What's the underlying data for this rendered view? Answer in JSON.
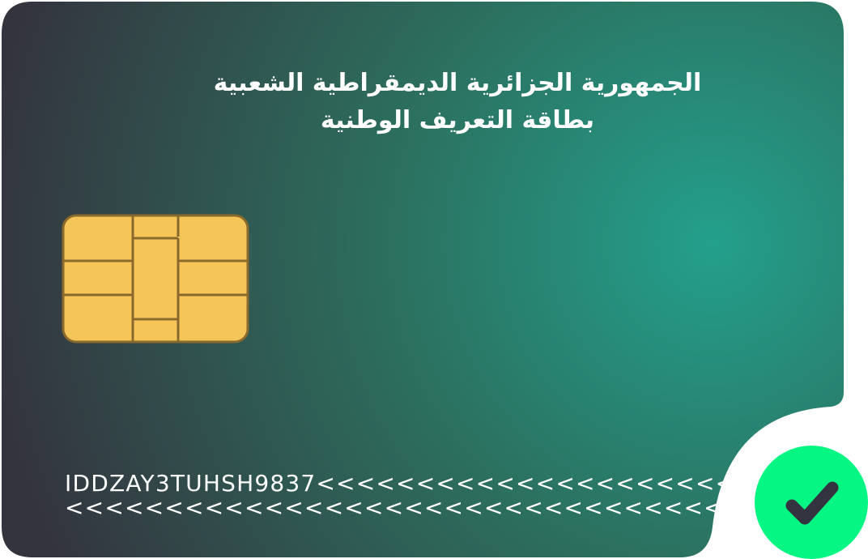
{
  "card": {
    "title_line1": "الجمهورية الجزائرية الديمقراطية الشعبية",
    "title_line2": "بطاقة التعريف الوطنية",
    "mrz_line1": "IDDZAY3TUHSH9837<<<<<<<<<<<<<<<<<<<<<",
    "mrz_line2": "<<<<<<<<<<<<<<<<<<<<<<<<<<<<<<<<<<<<<"
  },
  "colors": {
    "card_dark": "#34343e",
    "card_green": "#23a08c",
    "chip_gold": "#f5c55a",
    "chip_border": "#8a6a2c",
    "badge_green": "#06f684",
    "check_dark": "#33343f"
  },
  "icons": {
    "chip": "sim-chip-icon",
    "badge": "check-icon"
  }
}
